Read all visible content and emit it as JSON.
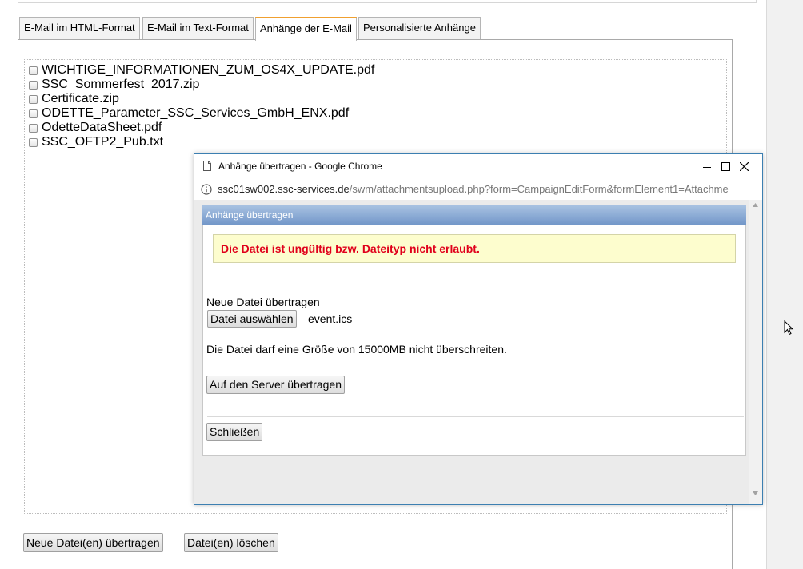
{
  "tabs": [
    {
      "label": "E-Mail im HTML-Format",
      "active": false
    },
    {
      "label": "E-Mail im Text-Format",
      "active": false
    },
    {
      "label": "Anhänge der E-Mail",
      "active": true
    },
    {
      "label": "Personalisierte Anhänge",
      "active": false
    }
  ],
  "attachments": [
    {
      "name": "WICHTIGE_INFORMATIONEN_ZUM_OS4X_UPDATE.pdf",
      "checked": false
    },
    {
      "name": "SSC_Sommerfest_2017.zip",
      "checked": false
    },
    {
      "name": "Certificate.zip",
      "checked": false
    },
    {
      "name": "ODETTE_Parameter_SSC_Services_GmbH_ENX.pdf",
      "checked": false
    },
    {
      "name": "OdetteDataSheet.pdf",
      "checked": false
    },
    {
      "name": "SSC_OFTP2_Pub.txt",
      "checked": false
    }
  ],
  "actions": {
    "upload_label": "Neue Datei(en) übertragen",
    "delete_label": "Datei(en) löschen"
  },
  "popup": {
    "window_title": "Anhänge übertragen - Google Chrome",
    "url_host": "ssc01sw002.ssc-services.de",
    "url_path": "/swm/attachmentsupload.php?form=CampaignEditForm&formElement1=Attachme",
    "section_title": "Anhänge übertragen",
    "error_message": "Die Datei ist ungültig bzw. Dateityp nicht erlaubt.",
    "new_file_label": "Neue Datei übertragen",
    "choose_file_label": "Datei auswählen",
    "chosen_file": "event.ics",
    "size_note": "Die Datei darf eine Größe von 15000MB nicht überschreiten.",
    "upload_button": "Auf den Server übertragen",
    "close_button": "Schließen"
  },
  "colors": {
    "active_tab_accent": "#f0a030",
    "header_gradient_top": "#a8c2e2",
    "header_gradient_bottom": "#7397c9",
    "error_text": "#e0001b",
    "error_background": "#fdfdce",
    "window_border": "#3c7fb1"
  },
  "icons": [
    "page-icon",
    "minimize-icon",
    "maximize-icon",
    "close-icon",
    "info-icon",
    "mouse-cursor-icon",
    "scroll-up-arrow-icon",
    "scroll-down-arrow-icon"
  ]
}
